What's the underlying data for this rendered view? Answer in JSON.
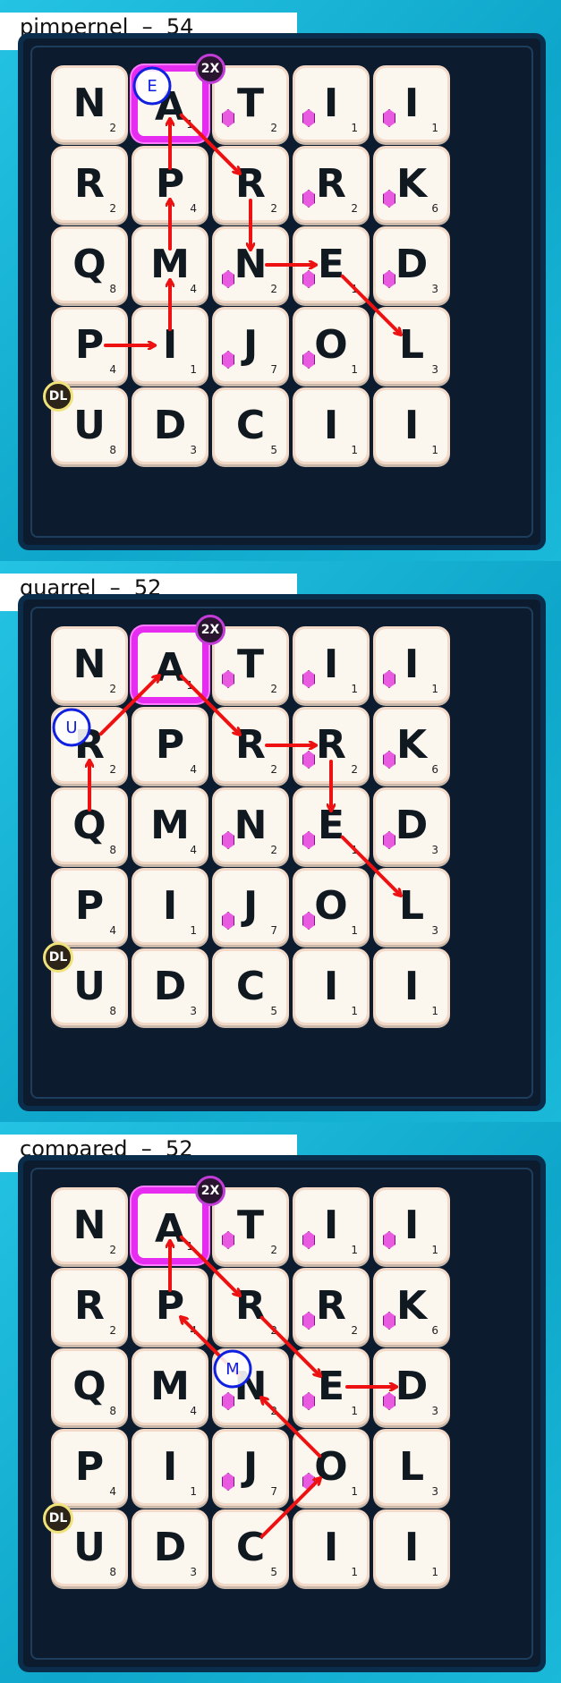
{
  "board": {
    "letters": [
      [
        "N",
        "A",
        "T",
        "I",
        "I"
      ],
      [
        "R",
        "P",
        "R",
        "R",
        "K"
      ],
      [
        "Q",
        "M",
        "N",
        "E",
        "D"
      ],
      [
        "P",
        "I",
        "J",
        "O",
        "L"
      ],
      [
        "U",
        "D",
        "C",
        "I",
        "I"
      ]
    ],
    "points": [
      [
        "2",
        "1",
        "2",
        "1",
        "1"
      ],
      [
        "2",
        "4",
        "2",
        "2",
        "6"
      ],
      [
        "8",
        "4",
        "2",
        "1",
        "3"
      ],
      [
        "4",
        "1",
        "7",
        "1",
        "3"
      ],
      [
        "8",
        "3",
        "5",
        "1",
        "1"
      ]
    ],
    "gem_tiles": [
      [
        0,
        2
      ],
      [
        0,
        3
      ],
      [
        0,
        4
      ],
      [
        1,
        3
      ],
      [
        1,
        4
      ],
      [
        2,
        2
      ],
      [
        2,
        3
      ],
      [
        2,
        4
      ],
      [
        3,
        2
      ],
      [
        3,
        3
      ]
    ],
    "double_word_tile": [
      0,
      1
    ],
    "double_word_label": "2X",
    "double_letter_tile": [
      4,
      0
    ],
    "double_letter_label": "DL"
  },
  "solutions": [
    {
      "label": "pimpernel  –  54",
      "path": [
        [
          3,
          0
        ],
        [
          3,
          1
        ],
        [
          2,
          1
        ],
        [
          1,
          1
        ],
        [
          0,
          1
        ],
        [
          1,
          2
        ],
        [
          2,
          2
        ],
        [
          2,
          3
        ],
        [
          3,
          4
        ]
      ],
      "swap": {
        "letter": "E",
        "tile": [
          0,
          1
        ]
      }
    },
    {
      "label": "quarrel  –  52",
      "path": [
        [
          2,
          0
        ],
        [
          1,
          0
        ],
        [
          0,
          1
        ],
        [
          1,
          2
        ],
        [
          1,
          3
        ],
        [
          2,
          3
        ],
        [
          3,
          4
        ]
      ],
      "swap": {
        "letter": "U",
        "tile": [
          1,
          0
        ]
      }
    },
    {
      "label": "compared  –  52",
      "path": [
        [
          4,
          2
        ],
        [
          3,
          3
        ],
        [
          2,
          2
        ],
        [
          1,
          1
        ],
        [
          0,
          1
        ],
        [
          1,
          2
        ],
        [
          2,
          3
        ],
        [
          2,
          4
        ]
      ],
      "swap": {
        "letter": "M",
        "tile": [
          2,
          2
        ]
      }
    }
  ],
  "colors": {
    "path": "#ee1111",
    "swap": "#1020e0",
    "double_word": "#e62cf0",
    "board": "#0d1b2e"
  }
}
